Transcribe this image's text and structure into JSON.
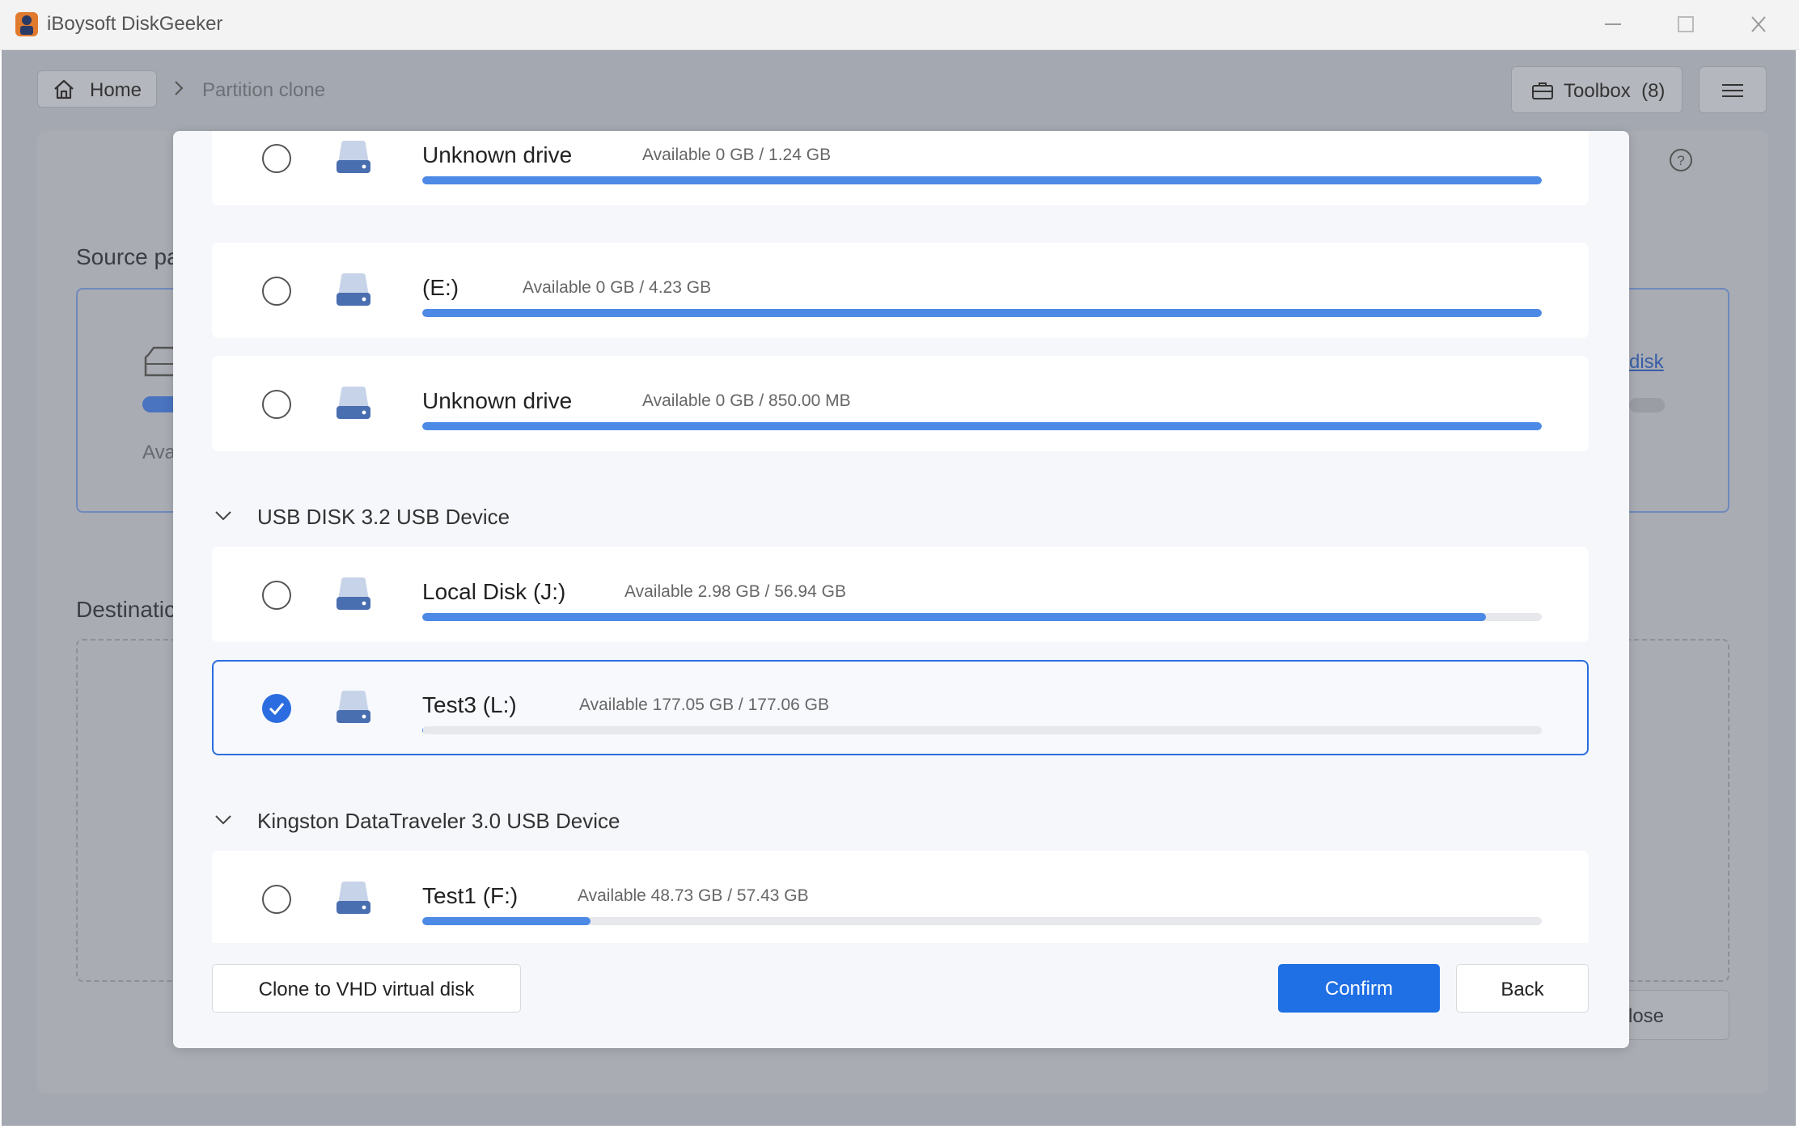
{
  "window": {
    "title": "iBoysoft DiskGeeker"
  },
  "topbar": {
    "home_label": "Home",
    "breadcrumb_current": "Partition clone",
    "toolbox_label": "Toolbox",
    "toolbox_count": "(8)"
  },
  "background": {
    "source_label": "Source pa",
    "source_avail_fragment": "Ava",
    "disk_link_fragment": "disk",
    "destination_label": "Destinatic",
    "close_fragment": "lose"
  },
  "modal": {
    "rows": [
      {
        "name": "Unknown drive",
        "available": "Available 0 GB / 1.24 GB",
        "used_fraction": 1.0,
        "selected": false
      },
      {
        "name": "(E:)",
        "available": "Available 0 GB / 4.23 GB",
        "used_fraction": 1.0,
        "selected": false
      },
      {
        "name": "Unknown drive",
        "available": "Available 0 GB / 850.00 MB",
        "used_fraction": 1.0,
        "selected": false
      }
    ],
    "groups": [
      {
        "device": "USB DISK 3.2 USB Device",
        "rows": [
          {
            "name": "Local Disk (J:)",
            "available": "Available 2.98 GB / 56.94 GB",
            "used_fraction": 0.95,
            "selected": false
          },
          {
            "name": "Test3 (L:)",
            "available": "Available 177.05 GB / 177.06 GB",
            "used_fraction": 0.001,
            "selected": true
          }
        ]
      },
      {
        "device": "Kingston DataTraveler 3.0 USB Device",
        "rows": [
          {
            "name": "Test1 (F:)",
            "available": "Available 48.73 GB / 57.43 GB",
            "used_fraction": 0.15,
            "selected": false
          }
        ]
      }
    ],
    "vhd_label": "Clone to VHD virtual disk",
    "confirm_label": "Confirm",
    "back_label": "Back"
  },
  "colors": {
    "accent": "#1f6fe5",
    "bar_fill": "#4d8ae6",
    "bar_track": "#e6e8ec"
  }
}
